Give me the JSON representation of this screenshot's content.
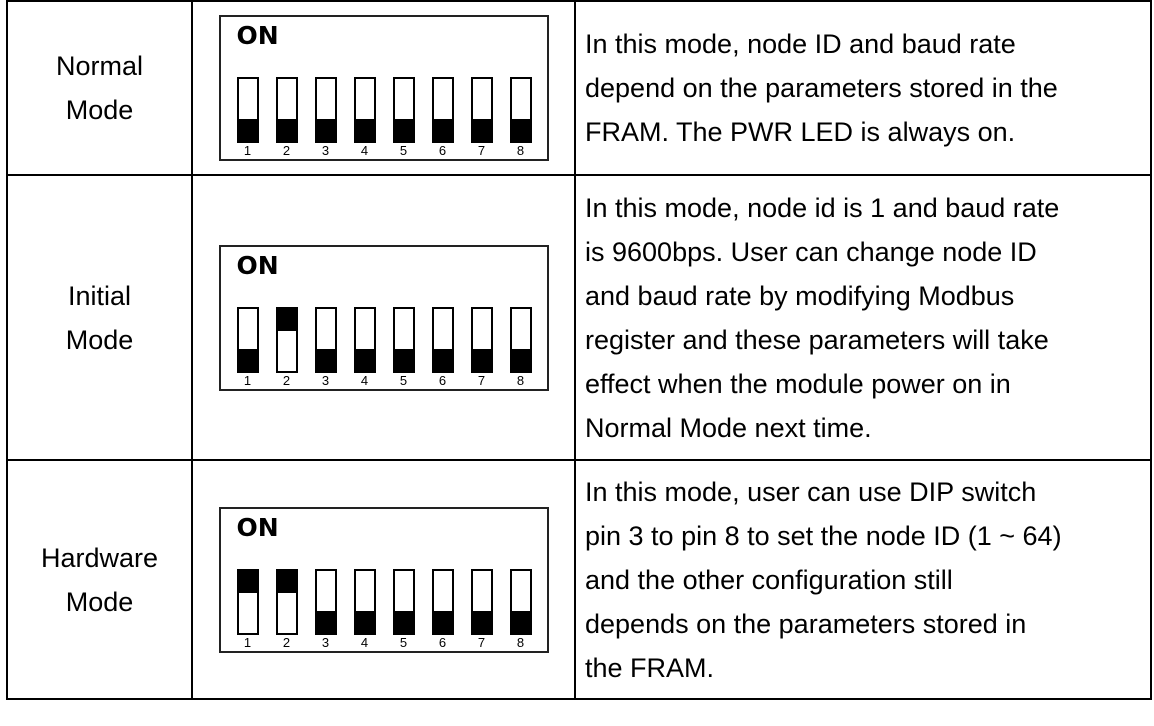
{
  "table": {
    "rows": [
      {
        "mode": [
          "Normal",
          "Mode"
        ],
        "dip": {
          "on_label": "ON",
          "pins": [
            "1",
            "2",
            "3",
            "4",
            "5",
            "6",
            "7",
            "8"
          ],
          "states": [
            "off",
            "off",
            "off",
            "off",
            "off",
            "off",
            "off",
            "off"
          ]
        },
        "description": [
          "In this mode, node ID and baud rate",
          "depend on the parameters stored in the",
          "FRAM. The PWR LED is always on."
        ]
      },
      {
        "mode": [
          "Initial",
          "Mode"
        ],
        "dip": {
          "on_label": "ON",
          "pins": [
            "1",
            "2",
            "3",
            "4",
            "5",
            "6",
            "7",
            "8"
          ],
          "states": [
            "off",
            "on",
            "off",
            "off",
            "off",
            "off",
            "off",
            "off"
          ]
        },
        "description": [
          "In this mode, node id is 1 and baud rate",
          "is 9600bps. User can change node ID",
          "and baud rate by modifying Modbus",
          "register and these parameters will take",
          "effect when the module power on in",
          "Normal Mode next time."
        ]
      },
      {
        "mode": [
          "Hardware",
          "Mode"
        ],
        "dip": {
          "on_label": "ON",
          "pins": [
            "1",
            "2",
            "3",
            "4",
            "5",
            "6",
            "7",
            "8"
          ],
          "states": [
            "on",
            "on",
            "off",
            "off",
            "off",
            "off",
            "off",
            "off"
          ]
        },
        "description": [
          "In this mode, user can use DIP switch",
          "pin 3 to pin 8 to set the node ID (1 ~ 64)",
          "and the other configuration still",
          "depends on the parameters stored in",
          "the FRAM."
        ]
      }
    ]
  }
}
